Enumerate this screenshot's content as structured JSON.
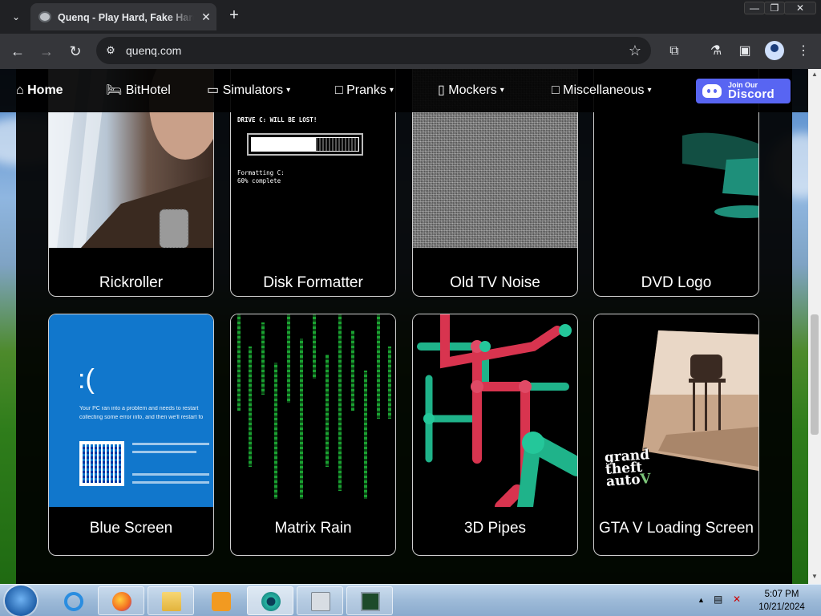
{
  "browser": {
    "tab_title": "Quenq - Play Hard, Fake Harder",
    "url": "quenq.com",
    "window_buttons": [
      "—",
      "❐",
      "✕"
    ]
  },
  "nav": {
    "home": "Home",
    "bithotel": "BitHotel",
    "simulators": "Simulators",
    "pranks": "Pranks",
    "mockers": "Mockers",
    "misc": "Miscellaneous",
    "discord_small": "Join Our",
    "discord_big": "Discord"
  },
  "cards": [
    {
      "label": "Rickroller"
    },
    {
      "label": "Disk Formatter"
    },
    {
      "label": "Old TV Noise"
    },
    {
      "label": "DVD Logo"
    },
    {
      "label": "Blue Screen"
    },
    {
      "label": "Matrix Rain"
    },
    {
      "label": "3D Pipes"
    },
    {
      "label": "GTA V Loading Screen"
    }
  ],
  "disk_formatter": {
    "warning": "DRIVE C: WILL BE LOST!",
    "status1": "Formatting C:",
    "status2": "60% complete",
    "progress": 0.6
  },
  "bsod": {
    "face": ":(",
    "line1": "Your PC ran into a problem and needs to restart",
    "line2": "collecting some error info, and then we'll restart fo"
  },
  "taskbar": {
    "time": "5:07 PM",
    "date": "10/21/2024"
  }
}
